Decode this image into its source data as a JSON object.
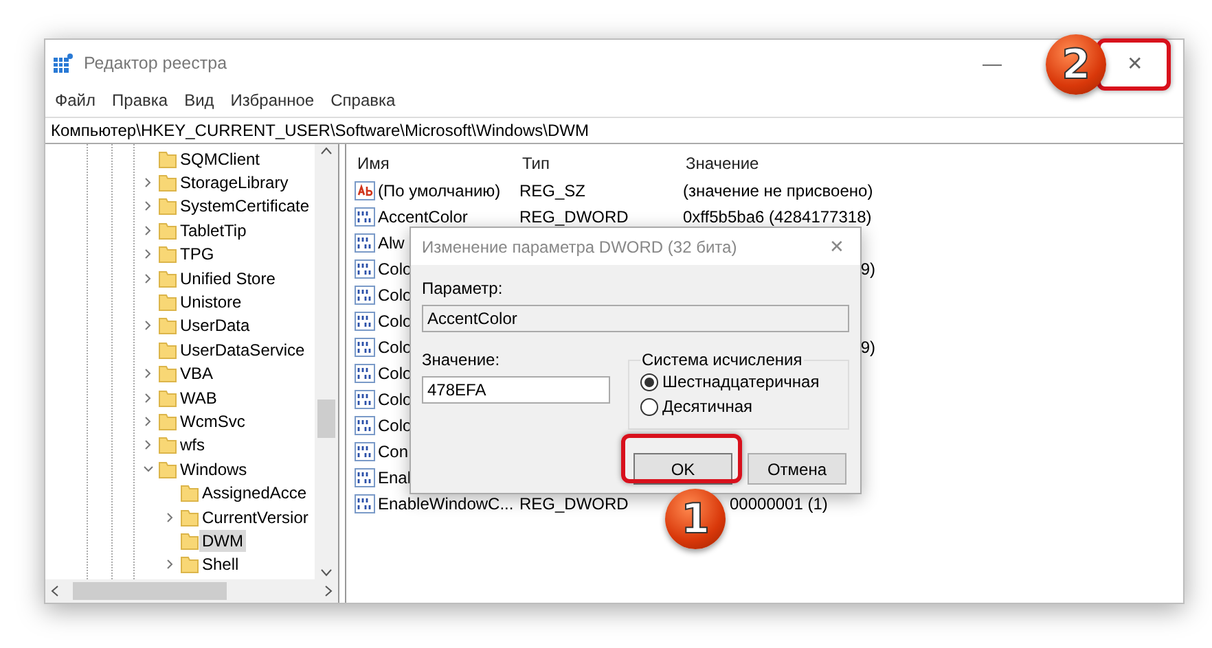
{
  "window": {
    "title": "Редактор реестра",
    "close": "✕",
    "minimize": "—"
  },
  "menu": [
    "Файл",
    "Правка",
    "Вид",
    "Избранное",
    "Справка"
  ],
  "address": "Компьютер\\HKEY_CURRENT_USER\\Software\\Microsoft\\Windows\\DWM",
  "tree": [
    {
      "label": "SQMClient",
      "kind": "leaf",
      "selected": false
    },
    {
      "label": "StorageLibrary",
      "kind": "branch",
      "expanded": false,
      "selected": false
    },
    {
      "label": "SystemCertificate",
      "kind": "branch",
      "expanded": false,
      "selected": false
    },
    {
      "label": "TabletTip",
      "kind": "branch",
      "expanded": false,
      "selected": false
    },
    {
      "label": "TPG",
      "kind": "branch",
      "expanded": false,
      "selected": false
    },
    {
      "label": "Unified Store",
      "kind": "branch",
      "expanded": false,
      "selected": false
    },
    {
      "label": "Unistore",
      "kind": "leaf",
      "selected": false
    },
    {
      "label": "UserData",
      "kind": "branch",
      "expanded": false,
      "selected": false
    },
    {
      "label": "UserDataService",
      "kind": "leaf",
      "selected": false
    },
    {
      "label": "VBA",
      "kind": "branch",
      "expanded": false,
      "selected": false
    },
    {
      "label": "WAB",
      "kind": "branch",
      "expanded": false,
      "selected": false
    },
    {
      "label": "WcmSvc",
      "kind": "branch",
      "expanded": false,
      "selected": false
    },
    {
      "label": "wfs",
      "kind": "branch",
      "expanded": false,
      "selected": false
    },
    {
      "label": "Windows",
      "kind": "branch",
      "expanded": true,
      "selected": false,
      "children": [
        {
          "label": "AssignedAcce",
          "kind": "leaf",
          "selected": false
        },
        {
          "label": "CurrentVersior",
          "kind": "branch",
          "expanded": false,
          "selected": false
        },
        {
          "label": "DWM",
          "kind": "leaf",
          "selected": true
        },
        {
          "label": "Shell",
          "kind": "branch",
          "expanded": false,
          "selected": false
        }
      ]
    }
  ],
  "table": {
    "columns": [
      "Имя",
      "Тип",
      "Значение"
    ],
    "rows": [
      {
        "kind": "string",
        "name": "(По умолчанию)",
        "type": "REG_SZ",
        "value": "(значение не присвоено)"
      },
      {
        "kind": "binary",
        "name": "AccentColor",
        "type": "REG_DWORD",
        "value": "0xff5b5ba6 (4284177318)"
      },
      {
        "kind": "binary",
        "name": "Alw"
      },
      {
        "kind": "binary",
        "name": "Colo",
        "value": "9)"
      },
      {
        "kind": "binary",
        "name": "Colo"
      },
      {
        "kind": "binary",
        "name": "Colo"
      },
      {
        "kind": "binary",
        "name": "Colo",
        "value": "9)"
      },
      {
        "kind": "binary",
        "name": "Colo"
      },
      {
        "kind": "binary",
        "name": "Colo"
      },
      {
        "kind": "binary",
        "name": "Colo"
      },
      {
        "kind": "binary",
        "name": "Con"
      },
      {
        "kind": "binary",
        "name": "Enal"
      },
      {
        "kind": "binary",
        "name": "EnableWindowC...",
        "type": "REG_DWORD",
        "value": "00000001 (1)"
      }
    ]
  },
  "dialog": {
    "title": "Изменение параметра DWORD (32 бита)",
    "close": "✕",
    "param_label": "Параметр:",
    "param_value": "AccentColor",
    "value_label": "Значение:",
    "value": "478EFA",
    "group": "Система исчисления",
    "radios": [
      {
        "label": "Шестнадцатеричная",
        "selected": true
      },
      {
        "label": "Десятичная",
        "selected": false
      }
    ],
    "buttons": [
      {
        "label": "OK",
        "highlighted": true
      },
      {
        "label": "Отмена",
        "highlighted": false
      }
    ]
  },
  "annotations": [
    {
      "label": "1"
    },
    {
      "label": "2"
    }
  ]
}
